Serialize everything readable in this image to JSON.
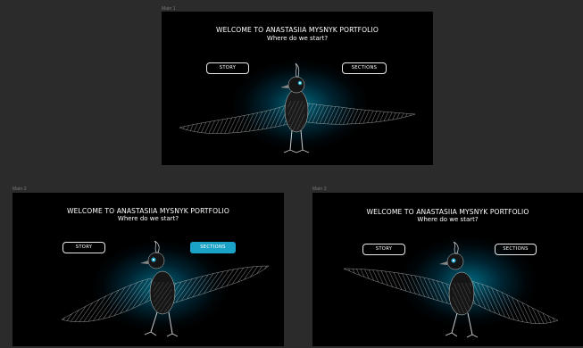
{
  "frames": [
    {
      "label": "Main 1",
      "title": "WELCOME TO ANASTASIIA MYSNYK PORTFOLIO",
      "subtitle": "Where do we start?",
      "story_label": "STORY",
      "sections_label": "SECTIONS",
      "sections_active": false
    },
    {
      "label": "Main 2",
      "title": "WELCOME TO ANASTASIIA MYSNYK PORTFOLIO",
      "subtitle": "Where do we start?",
      "story_label": "STORY",
      "sections_label": "SECTIONS",
      "sections_active": true
    },
    {
      "label": "Main 3",
      "title": "WELCOME TO ANASTASIIA MYSNYK PORTFOLIO",
      "subtitle": "Where do we start?",
      "story_label": "STORY",
      "sections_label": "SECTIONS",
      "sections_active": false
    }
  ],
  "colors": {
    "canvas_bg": "#2b2b2b",
    "frame_bg": "#000000",
    "accent": "#1aa3c6",
    "glow": "#007a96",
    "text": "#ffffff"
  },
  "icons": {
    "hero": "raven-illustration"
  }
}
